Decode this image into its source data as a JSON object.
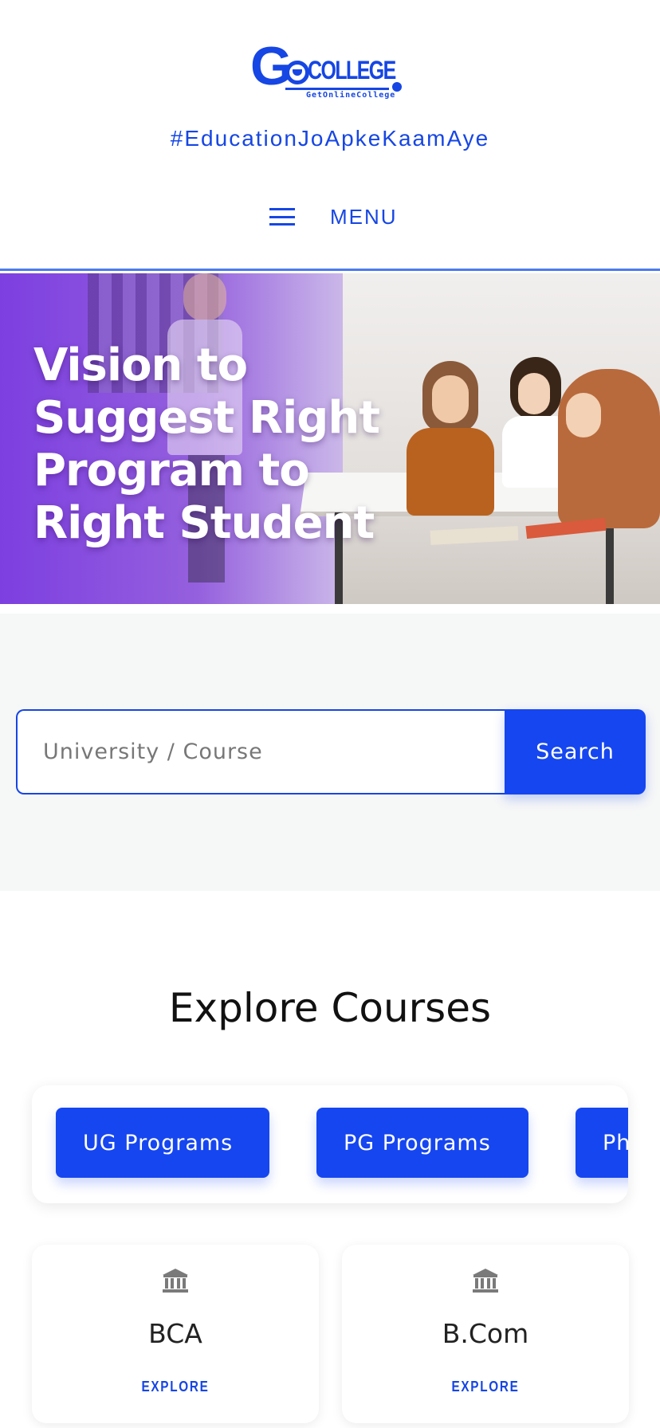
{
  "header": {
    "logo_text_g": "G",
    "logo_text_college": "COLLEGE",
    "logo_subtext": "GetOnlineCollege",
    "tagline": "#EducationJoApkeKaamAye",
    "menu_label": "MENU"
  },
  "hero": {
    "headline": "Vision to Suggest Right Program to Right Student"
  },
  "search": {
    "placeholder": "University / Course",
    "button_label": "Search"
  },
  "explore": {
    "title": "Explore Courses",
    "tabs": [
      {
        "label": "UG Programs"
      },
      {
        "label": "PG Programs"
      },
      {
        "label": "Ph"
      }
    ],
    "courses": [
      {
        "name": "BCA",
        "link": "EXPLORE",
        "icon": "bank-icon"
      },
      {
        "name": "B.Com",
        "link": "EXPLORE",
        "icon": "bank-icon"
      }
    ]
  },
  "colors": {
    "brand_blue": "#1646e3",
    "button_blue": "#1646f0",
    "hero_purple": "#7d3fe0",
    "search_bg": "#f6f7f7"
  }
}
